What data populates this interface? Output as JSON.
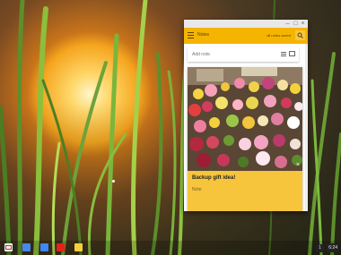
{
  "window": {
    "controls": {
      "minimize": "–",
      "maximize": "□",
      "close": "×"
    }
  },
  "keep": {
    "app_title": "Notes",
    "sync_status": "all notes saved",
    "add_note_placeholder": "Add note",
    "note": {
      "title": "Backup gift idea!",
      "body": "Note",
      "image_alt": "flowers",
      "close_glyph": "×"
    }
  },
  "shelf": {
    "apps": [
      {
        "name": "gmail-icon"
      },
      {
        "name": "google-search-icon"
      },
      {
        "name": "docs-icon"
      },
      {
        "name": "youtube-icon"
      },
      {
        "name": "keep-icon"
      }
    ],
    "badge": "1",
    "time": "6:24"
  },
  "colors": {
    "keep_header": "#f4b400",
    "note_card": "#f6c53c",
    "shelf_bg": "rgba(0,0,0,0.18)"
  }
}
